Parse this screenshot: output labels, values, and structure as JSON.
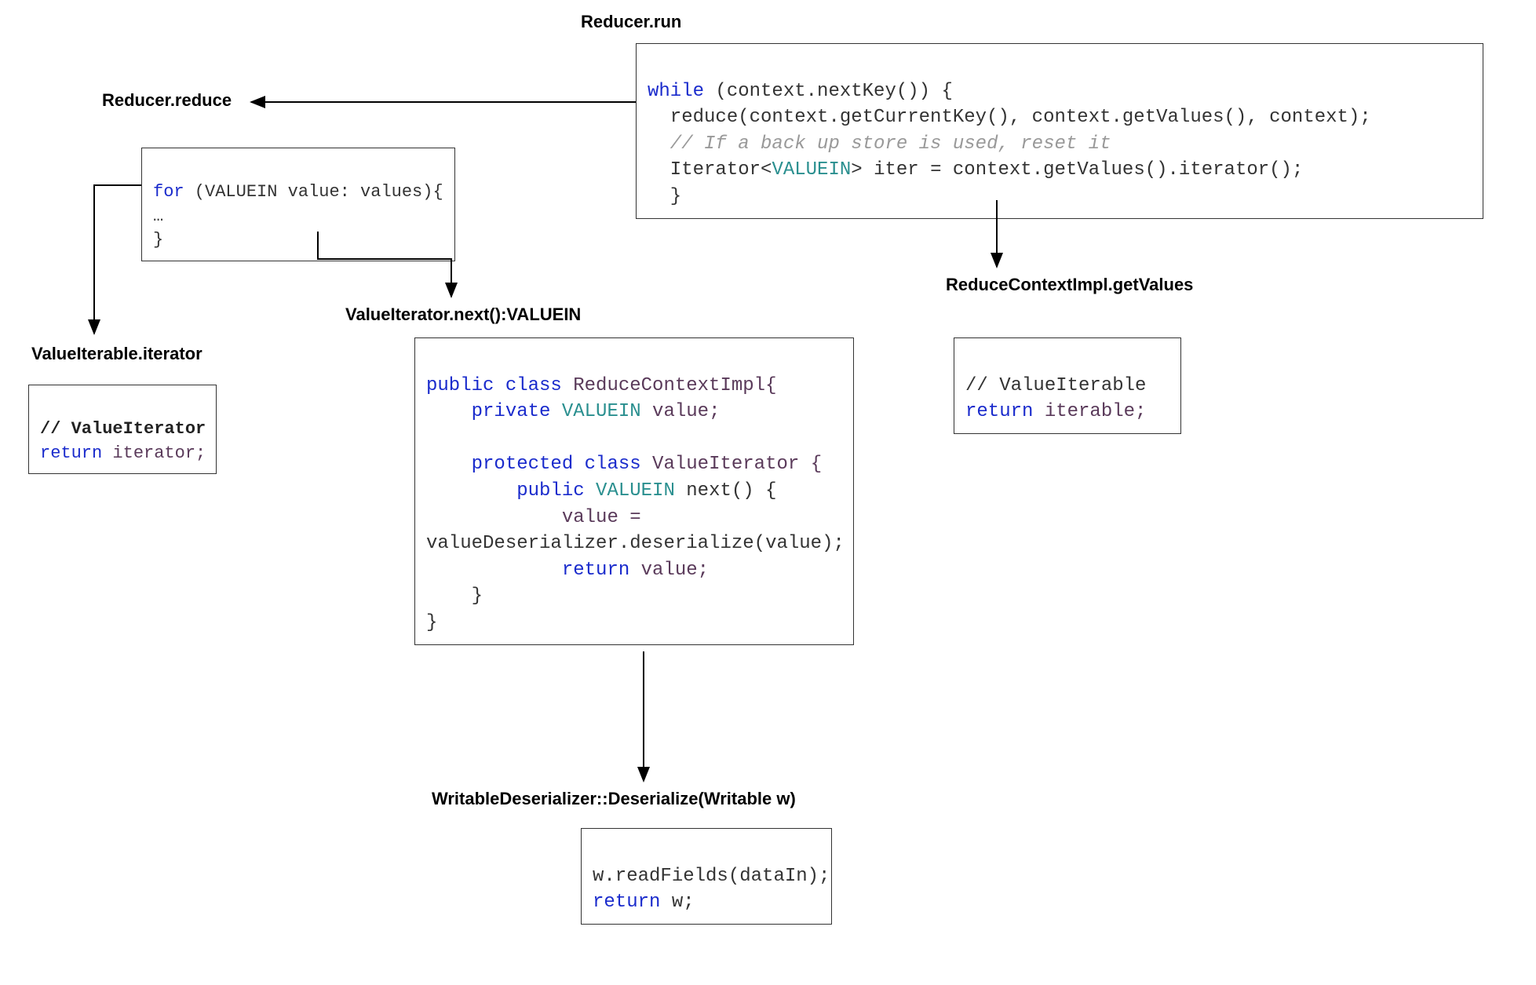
{
  "titles": {
    "run": "Reducer.run",
    "reduce": "Reducer.reduce",
    "iterable": "ValueIterable.iterator",
    "next": "ValueIterator.next():VALUEIN",
    "getvalues": "ReduceContextImpl.getValues",
    "deser": "WritableDeserializer::Deserialize(Writable w)"
  },
  "code": {
    "run_l1a": "while",
    "run_l1b": " (context.nextKey()) {",
    "run_l2": "  reduce(context.getCurrentKey(), context.getValues(), context);",
    "run_l3": "  // If a back up store is used, reset it",
    "run_l4a": "  Iterator<",
    "run_l4b": "VALUEIN",
    "run_l4c": "> iter = context.getValues().iterator();",
    "run_l5": "  }",
    "reduce_l1a": "for",
    "reduce_l1b": " (VALUEIN value: values){",
    "reduce_l2": "…",
    "reduce_l3": "}",
    "iter_l1": "// ValueIterator",
    "iter_l2a": "return",
    "iter_l2b": " iterator;",
    "gv_l1": "// ValueIterable",
    "gv_l2a": "return",
    "gv_l2b": " iterable;",
    "ctx_l1a": "public class",
    "ctx_l1b": " ReduceContextImpl{",
    "ctx_l2a": "    private",
    "ctx_l2b": " VALUEIN",
    "ctx_l2c": " value;",
    "ctx_l3a": "    protected class",
    "ctx_l3b": " ValueIterator {",
    "ctx_l4a": "        public",
    "ctx_l4b": " VALUEIN",
    "ctx_l4c": " next() {",
    "ctx_l5": "            value =",
    "ctx_l6": "valueDeserializer.deserialize(value);",
    "ctx_l7a": "            return",
    "ctx_l7b": " value;",
    "ctx_l8": "    }",
    "ctx_l9": "}",
    "des_l1": "w.readFields(dataIn);",
    "des_l2a": "return",
    "des_l2b": " w;"
  }
}
